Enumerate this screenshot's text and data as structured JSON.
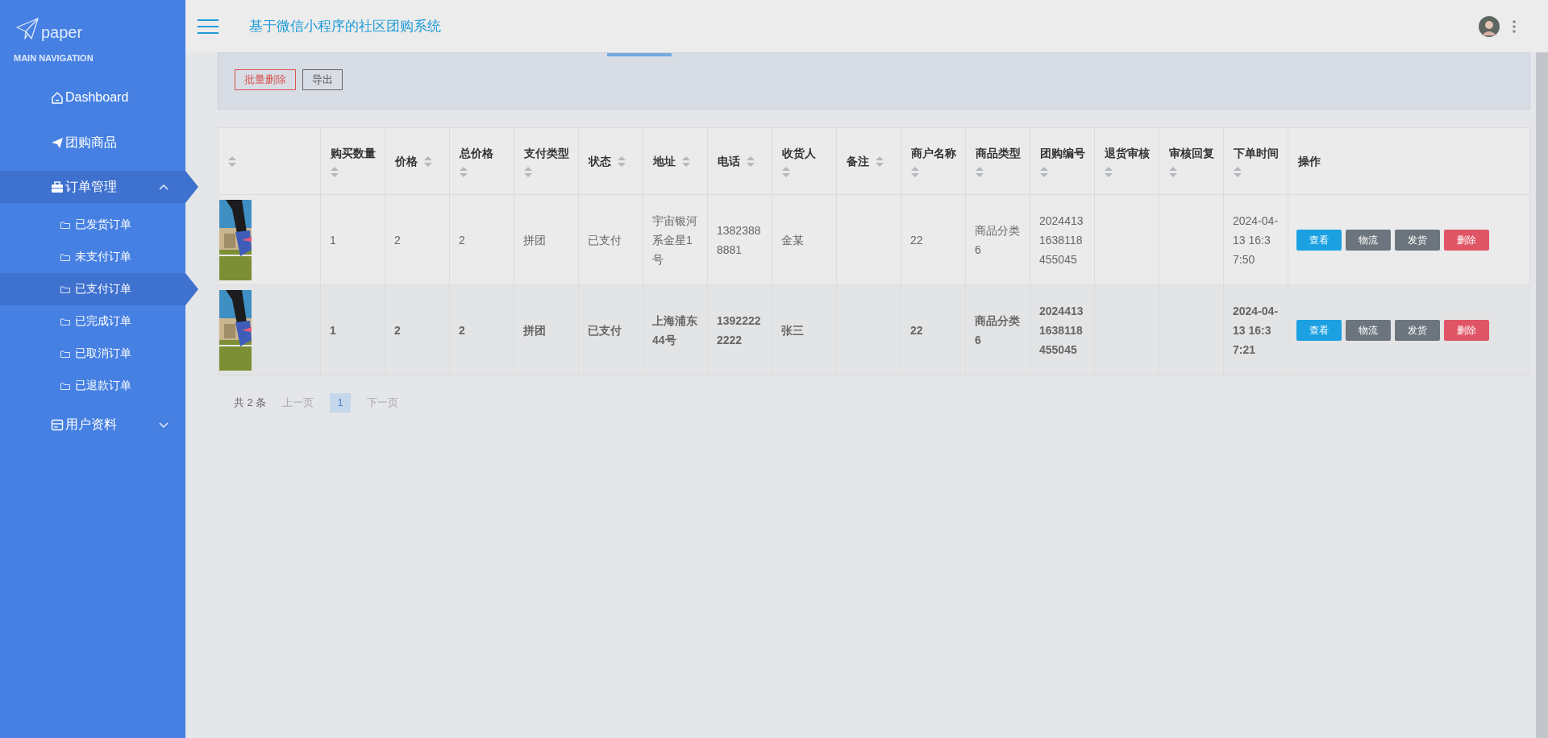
{
  "sidebar": {
    "logo": "paper",
    "section_title": "MAIN NAVIGATION",
    "items": [
      {
        "label": "Dashboard",
        "selected": false
      },
      {
        "label": "团购商品",
        "selected": false
      },
      {
        "label": "订单管理",
        "selected": true,
        "kind": "group",
        "expanded": true,
        "children": [
          {
            "label": "已发货订单",
            "selected": false
          },
          {
            "label": "未支付订单",
            "selected": false
          },
          {
            "label": "已支付订单",
            "selected": true
          },
          {
            "label": "已完成订单",
            "selected": false
          },
          {
            "label": "已取消订单",
            "selected": false
          },
          {
            "label": "已退款订单",
            "selected": false
          }
        ]
      },
      {
        "label": "用户资料",
        "selected": false,
        "kind": "group",
        "expanded": false
      }
    ]
  },
  "header": {
    "title": "基于微信小程序的社区团购系统"
  },
  "toolbar": {
    "buttons": [
      {
        "label": "批量删除",
        "kind": "danger"
      },
      {
        "label": "导出",
        "kind": "default"
      }
    ]
  },
  "table": {
    "columns": [
      {
        "sortable": true
      },
      {
        "label": "购买数量",
        "sortable": true
      },
      {
        "label": "价格",
        "sortable": true
      },
      {
        "label": "总价格",
        "sortable": true
      },
      {
        "label": "支付类型",
        "sortable": true
      },
      {
        "label": "状态",
        "sortable": true
      },
      {
        "label": "地址",
        "sortable": true
      },
      {
        "label": "电话",
        "sortable": true
      },
      {
        "label": "收货人",
        "sortable": true
      },
      {
        "label": "备注",
        "sortable": true
      },
      {
        "label": "商户名称",
        "sortable": true
      },
      {
        "label": "商品类型",
        "sortable": true
      },
      {
        "label": "团购编号",
        "sortable": true
      },
      {
        "label": "退货审核",
        "sortable": true
      },
      {
        "label": "审核回复",
        "sortable": true
      },
      {
        "label": "下单时间",
        "sortable": true
      },
      {
        "label": "操作",
        "sortable": false
      }
    ],
    "rows": [
      {
        "hovered": false,
        "cells": [
          {
            "kind": "picture"
          },
          "1",
          "2",
          "2",
          "拼团",
          "已支付",
          "宇宙银河系金星1号",
          "13823888881",
          "金某",
          null,
          "22",
          "商品分类6",
          "20244131638118455045",
          null,
          null,
          "2024-04-13 16:37:50"
        ],
        "actions": [
          {
            "label": "查看",
            "kind": "info"
          },
          {
            "label": "物流",
            "kind": "secondary"
          },
          {
            "label": "发货",
            "kind": "secondary"
          },
          {
            "label": "删除",
            "kind": "danger"
          }
        ]
      },
      {
        "hovered": true,
        "cells": [
          {
            "kind": "picture"
          },
          "1",
          "2",
          "2",
          "拼团",
          "已支付",
          "上海浦东44号",
          "13922222222",
          "张三",
          null,
          "22",
          "商品分类6",
          "20244131638118455045",
          null,
          null,
          "2024-04-13 16:37:21"
        ],
        "actions": [
          {
            "label": "查看",
            "kind": "info"
          },
          {
            "label": "物流",
            "kind": "secondary"
          },
          {
            "label": "发货",
            "kind": "secondary"
          },
          {
            "label": "删除",
            "kind": "danger"
          }
        ]
      }
    ]
  },
  "pagination": {
    "total": "共 2 条",
    "prev": "上一页",
    "pages": [
      {
        "label": "1",
        "selected": true
      }
    ],
    "next": "下一页"
  }
}
